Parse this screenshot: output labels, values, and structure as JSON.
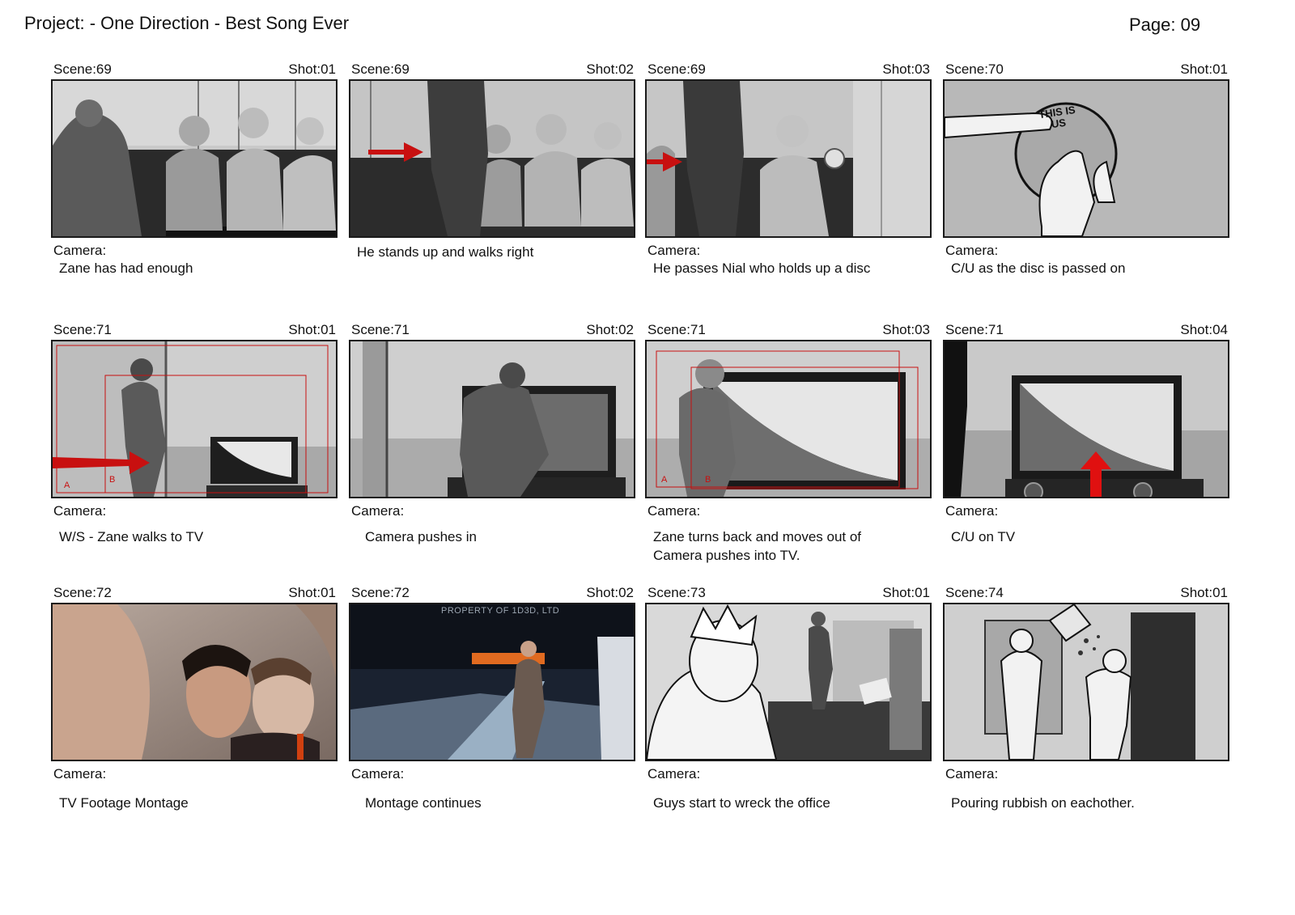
{
  "header": {
    "project": "Project:  - One Direction - Best Song Ever",
    "page": "Page: 09"
  },
  "panels": [
    {
      "scene": "Scene:69",
      "shot": "Shot:01",
      "camera_label": "Camera:",
      "caption": "Zane has had enough"
    },
    {
      "scene": "Scene:69",
      "shot": "Shot:02",
      "camera_label": "",
      "caption": "He stands up and walks right"
    },
    {
      "scene": "Scene:69",
      "shot": "Shot:03",
      "camera_label": "Camera:",
      "caption": "He passes Nial who holds up a disc"
    },
    {
      "scene": "Scene:70",
      "shot": "Shot:01",
      "camera_label": "Camera:",
      "caption": "C/U as the disc is passed on",
      "disc_text": "THIS IS US"
    },
    {
      "scene": "Scene:71",
      "shot": "Shot:01",
      "camera_label": "Camera:",
      "caption": "W/S - Zane walks to TV",
      "frame_a": "A",
      "frame_b": "B"
    },
    {
      "scene": "Scene:71",
      "shot": "Shot:02",
      "camera_label": "Camera:",
      "caption": "Camera pushes in"
    },
    {
      "scene": "Scene:71",
      "shot": "Shot:03",
      "camera_label": "Camera:",
      "caption": "Zane turns back and moves out of Camera pushes into TV.",
      "frame_a": "A",
      "frame_b": "B"
    },
    {
      "scene": "Scene:71",
      "shot": "Shot:04",
      "camera_label": "Camera:",
      "caption": "C/U on TV"
    },
    {
      "scene": "Scene:72",
      "shot": "Shot:01",
      "camera_label": "Camera:",
      "caption": "TV Footage Montage"
    },
    {
      "scene": "Scene:72",
      "shot": "Shot:02",
      "camera_label": "Camera:",
      "caption": "Montage continues",
      "watermark": "PROPERTY OF 1D3D, LTD"
    },
    {
      "scene": "Scene:73",
      "shot": "Shot:01",
      "camera_label": "Camera:",
      "caption": "Guys start to wreck the office"
    },
    {
      "scene": "Scene:74",
      "shot": "Shot:01",
      "camera_label": "Camera:",
      "caption": "Pouring rubbish on eachother."
    }
  ]
}
